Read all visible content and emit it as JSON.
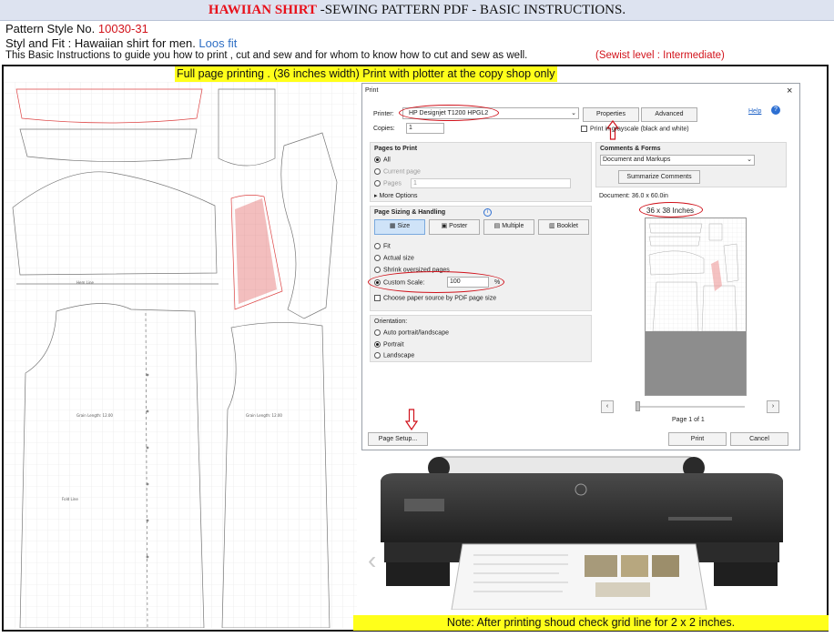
{
  "header": {
    "title_red": "HAWIIAN SHIRT",
    "title_rest": " -SEWING PATTERN PDF -  BASIC INSTRUCTIONS.",
    "pattern_style_label": "Pattern  Style   No. ",
    "pattern_style_number": "10030-31",
    "style_fit_label": "Styl and Fit :   Hawaiian shirt for men.  ",
    "style_fit_value": "Loos fit",
    "instructions": "This Basic Instructions  to guide you  how to print , cut and sew and for whom  to know how to cut and sew as well.",
    "sewist_level": "(Sewist level : Intermediate)"
  },
  "banner": "Full page printing . (36 inches  width)  Print with plotter at the copy shop only",
  "pattern_labels": {
    "label_a": "Grain Length: 12.00",
    "label_b": "Grain Length: 12.00",
    "label_c": "Fold Line",
    "label_d": "Hem Line"
  },
  "print_dialog": {
    "title": "Print",
    "close": "×",
    "printer_label": "Printer:",
    "printer_value": "HP Designjet T1200 HPGL2",
    "properties": "Properties",
    "advanced": "Advanced",
    "help": "Help",
    "copies_label": "Copies:",
    "copies_value": "1",
    "grayscale": "Print in grayscale (black and white)",
    "pages_to_print": "Pages to Print",
    "opt_all": "All",
    "opt_current": "Current page",
    "opt_pages": "Pages",
    "pages_value": "1",
    "more_options": "More Options",
    "sizing_title": "Page Sizing & Handling",
    "tab_size": "Size",
    "tab_poster": "Poster",
    "tab_multiple": "Multiple",
    "tab_booklet": "Booklet",
    "opt_fit": "Fit",
    "opt_actual": "Actual size",
    "opt_shrink": "Shrink oversized pages",
    "opt_custom": "Custom Scale:",
    "scale_value": "100",
    "scale_unit": "%",
    "paper_source": "Choose paper source by PDF page size",
    "orientation": "Orientation:",
    "orient_auto": "Auto portrait/landscape",
    "orient_portrait": "Portrait",
    "orient_landscape": "Landscape",
    "comments_title": "Comments & Forms",
    "comments_value": "Document and Markups",
    "summarize": "Summarize Comments",
    "document_size": "Document: 36.0 x 60.0in",
    "size_callout": "36 x 38 Inches",
    "page_of": "Page 1 of 1",
    "page_setup": "Page Setup...",
    "print": "Print",
    "cancel": "Cancel"
  },
  "note": "Note:  After printing shoud check grid line for 2 x 2 inches."
}
